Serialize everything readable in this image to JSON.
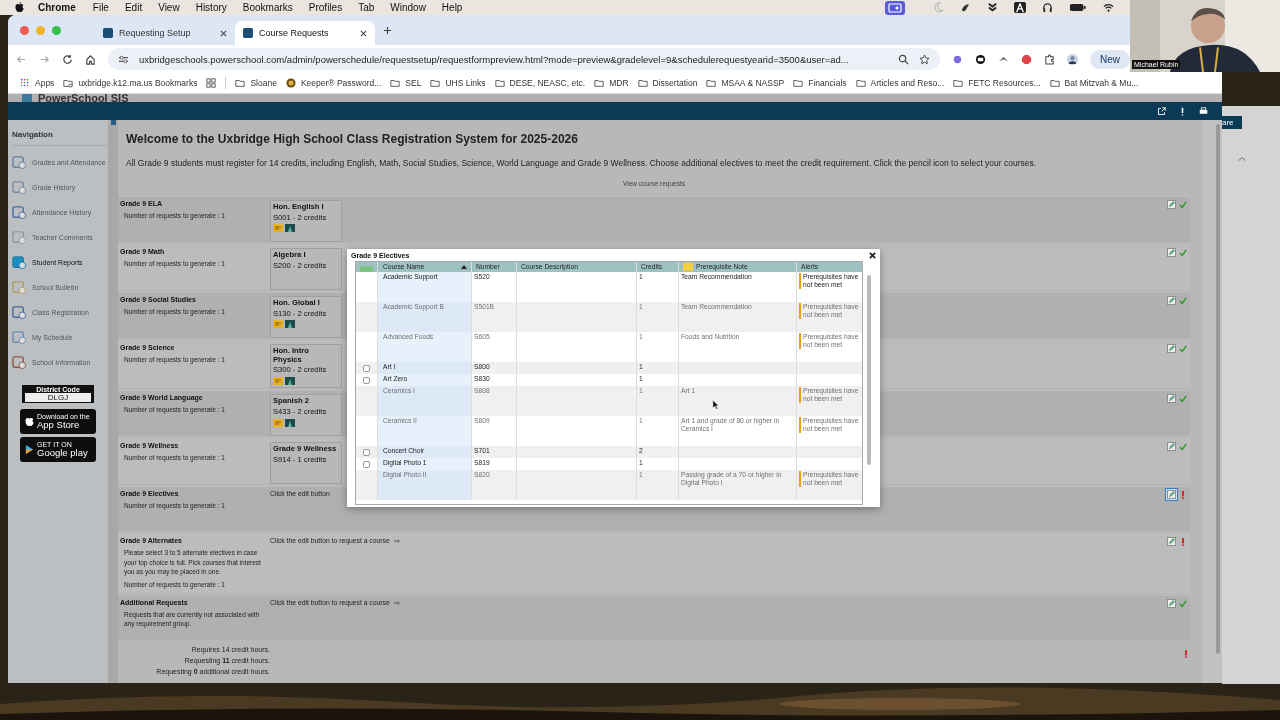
{
  "menubar": {
    "app": "Chrome",
    "menus": [
      "File",
      "Edit",
      "View",
      "History",
      "Bookmarks",
      "Profiles",
      "Tab",
      "Window",
      "Help"
    ]
  },
  "tabs": [
    {
      "label": "Requesting Setup",
      "selected": false
    },
    {
      "label": "Course Requests",
      "selected": true
    }
  ],
  "address": {
    "url": "uxbridgeschools.powerschool.com/admin/powerschedule/requestsetup/requestformpreview.html?mode=preview&gradelevel=9&schedulerequestyearid=3500&user=ad..."
  },
  "toolbar": {
    "new_button": "New"
  },
  "bookmarks": [
    {
      "label": "Apps",
      "kind": "apps"
    },
    {
      "label": "uxbridge.k12.ma.us Bookmarks",
      "kind": "managed"
    },
    {
      "label": "Sloane",
      "kind": "folder"
    },
    {
      "label": "Keeper® Password...",
      "kind": "site"
    },
    {
      "label": "SEL",
      "kind": "folder"
    },
    {
      "label": "UHS Links",
      "kind": "folder"
    },
    {
      "label": "DESE, NEASC, etc.",
      "kind": "folder"
    },
    {
      "label": "MDR",
      "kind": "folder"
    },
    {
      "label": "Dissertation",
      "kind": "folder"
    },
    {
      "label": "MSAA & NASSP",
      "kind": "folder"
    },
    {
      "label": "Financials",
      "kind": "folder"
    },
    {
      "label": "Articles and Reso...",
      "kind": "folder"
    },
    {
      "label": "FETC Resources...",
      "kind": "folder"
    },
    {
      "label": "Bat Mitzvah & Mu...",
      "kind": "folder"
    }
  ],
  "app": {
    "logo": "PowerSchool SIS",
    "share": "are"
  },
  "navigation": {
    "title": "Navigation",
    "items": [
      {
        "label": "Grades and Attendance",
        "selected": false
      },
      {
        "label": "Grade History",
        "selected": false
      },
      {
        "label": "Attendance History",
        "selected": false
      },
      {
        "label": "Teacher Comments",
        "selected": false
      },
      {
        "label": "Student Reports",
        "selected": true
      },
      {
        "label": "School Bulletin",
        "selected": false
      },
      {
        "label": "Class Registration",
        "selected": false
      },
      {
        "label": "My Schedule",
        "selected": false
      },
      {
        "label": "School Information",
        "selected": false
      }
    ],
    "district": {
      "label": "District Code",
      "code": "DLGJ"
    },
    "stores": [
      {
        "small": "Download on the",
        "big": "App Store",
        "kind": "apple"
      },
      {
        "small": "GET IT ON",
        "big": "Google play",
        "kind": "google"
      }
    ]
  },
  "main": {
    "title": "Welcome to the Uxbridge High School Class Registration System for 2025-2026",
    "intro": "All Grade 9 students must register for 14 credits, including English, Math, Social Studies, Science, World Language and Grade 9 Wellness. Choose additional electives to meet the credit requirement. Click the pencil icon to select your courses.",
    "link": "View course requests",
    "requirements": [
      {
        "title": "Grade 9 ELA",
        "requests": "Number of requests to generate : 1",
        "course": {
          "name": "Hon. English I",
          "detail": "S001 - 2 credits",
          "has_icons": true
        },
        "complete": true,
        "focused": false
      },
      {
        "title": "Grade 9 Math",
        "requests": "Number of requests to generate : 1",
        "course": {
          "name": "Algebra I",
          "detail": "S200 - 2 credits",
          "has_icons": false
        },
        "complete": true,
        "focused": false
      },
      {
        "title": "Grade 9 Social Studies",
        "requests": "Number of requests to generate : 1",
        "course": {
          "name": "Hon. Global I",
          "detail": "S130 - 2 credits",
          "has_icons": true
        },
        "complete": true,
        "focused": false
      },
      {
        "title": "Grade 9 Science",
        "requests": "Number of requests to generate : 1",
        "course": {
          "name": "Hon. Intro Physics",
          "detail": "S300 - 2 credits",
          "has_icons": true
        },
        "complete": true,
        "focused": false
      },
      {
        "title": "Grade 9 World Language",
        "requests": "Number of requests to generate : 1",
        "course": {
          "name": "Spanish 2",
          "detail": "S433 - 2 credits",
          "has_icons": true
        },
        "complete": true,
        "focused": false
      },
      {
        "title": "Grade 9 Wellness",
        "requests": "Number of requests to generate : 1",
        "course": {
          "name": "Grade 9 Wellness",
          "detail": "S914 - 1 credits",
          "has_icons": false
        },
        "complete": true,
        "focused": false
      },
      {
        "title": "Grade 9 Electives",
        "requests": "Number of requests to generate : 1",
        "prompt": "Click the edit button",
        "complete": false,
        "focused": true
      },
      {
        "title": "Grade 9 Alternates",
        "note": "Please select 3 to 5 alternate electives in case your top choice is full. Pick courses that interest you as you may be placed in one.",
        "requests": "Number of requests to generate : 1",
        "prompt": "Click the edit button to request a course",
        "complete": false,
        "focused": false
      },
      {
        "title": "Additional Requests",
        "note": "Requests that are currently not associated with any requirement group.",
        "prompt": "Click the edit button to request a course",
        "complete": true,
        "focused": false
      }
    ],
    "totals": [
      "Requires 14 credit hours.",
      "Requesting **11** credit hours.",
      "Requesting **0** additional credit hours."
    ],
    "totals_complete": false
  },
  "dialog": {
    "title": "Grade 9 Electives",
    "columns": [
      "Course Name",
      "Number",
      "Course Description",
      "Credits",
      "Prerequisite Note",
      "Alerts"
    ],
    "rows": [
      {
        "name": "Academic Support",
        "number": "S520",
        "credits": "1",
        "note": "Team Recommendation",
        "alert": "Prerequisites have not been met",
        "selectable": false,
        "dimmed": false
      },
      {
        "name": "Academic Support B",
        "number": "S501B",
        "credits": "1",
        "note": "Team Recommendation",
        "alert": "Prerequisites have not been met",
        "selectable": false,
        "dimmed": true
      },
      {
        "name": "Advanced Foods",
        "number": "S605",
        "credits": "1",
        "note": "Foods and Nutrition",
        "alert": "Prerequisites have not been met",
        "selectable": false,
        "dimmed": true
      },
      {
        "name": "Art I",
        "number": "S800",
        "credits": "1",
        "selectable": true,
        "checked": false,
        "dimmed": false
      },
      {
        "name": "Art Zero",
        "number": "S830",
        "credits": "1",
        "selectable": true,
        "checked": false,
        "dimmed": false
      },
      {
        "name": "Ceramics I",
        "number": "S808",
        "credits": "1",
        "note": "Art 1",
        "alert": "Prerequisites have not been met",
        "selectable": false,
        "dimmed": true
      },
      {
        "name": "Ceramics II",
        "number": "S809",
        "credits": "1",
        "note": "Art 1 and grade of 80 or higher in Ceramics I",
        "alert": "Prerequisites have not been met",
        "selectable": false,
        "dimmed": true
      },
      {
        "name": "Concert Choir",
        "number": "S701",
        "credits": "2",
        "selectable": true,
        "checked": false,
        "dimmed": false
      },
      {
        "name": "Digital Photo 1",
        "number": "S819",
        "credits": "1",
        "selectable": true,
        "checked": false,
        "dimmed": false
      },
      {
        "name": "Digital Photo II",
        "number": "S820",
        "credits": "1",
        "note": "Passing grade of a 70 or higher in Digital Photo I",
        "alert": "Prerequisites have not been met",
        "selectable": false,
        "dimmed": true
      }
    ]
  },
  "webcam": {
    "name": "Michael Rubin"
  }
}
